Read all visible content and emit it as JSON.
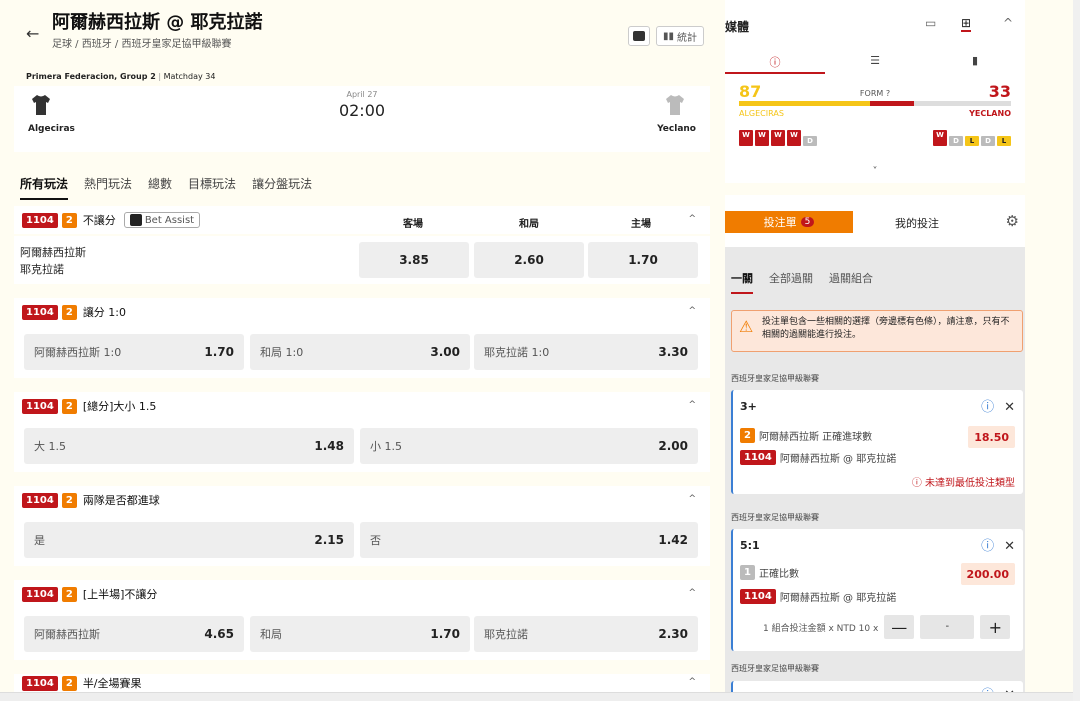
{
  "header": {
    "back_icon": "back-arrow-icon",
    "title": "阿爾赫西拉斯 @ 耶克拉諾",
    "breadcrumb": "足球 / 西班牙 / 西班牙皇家足協甲級聯賽",
    "stats_label": "統計"
  },
  "match": {
    "competition": "Primera Federacion, Group 2",
    "matchday": "Matchday 34",
    "date": "April 27",
    "time": "02:00",
    "home": "Algeciras",
    "away": "Yeclano"
  },
  "tabs": [
    "所有玩法",
    "熱門玩法",
    "總數",
    "目標玩法",
    "讓分盤玩法"
  ],
  "markets": {
    "m1": {
      "code": "1104",
      "num": "2",
      "name": "不讓分",
      "bet_assist": "Bet Assist",
      "cols": [
        "客場",
        "和局",
        "主場"
      ],
      "teams_line1": "阿爾赫西拉斯",
      "teams_line2": "耶克拉諾",
      "odds": [
        "3.85",
        "2.60",
        "1.70"
      ]
    },
    "m2": {
      "code": "1104",
      "num": "2",
      "name": "讓分 1:0",
      "sel": [
        [
          "阿爾赫西拉斯 1:0",
          "1.70"
        ],
        [
          "和局 1:0",
          "3.00"
        ],
        [
          "耶克拉諾 1:0",
          "3.30"
        ]
      ]
    },
    "m3": {
      "code": "1104",
      "num": "2",
      "name": "[總分]大小 1.5",
      "sel": [
        [
          "大 1.5",
          "1.48"
        ],
        [
          "小 1.5",
          "2.00"
        ]
      ]
    },
    "m4": {
      "code": "1104",
      "num": "2",
      "name": "兩隊是否都進球",
      "sel": [
        [
          "是",
          "2.15"
        ],
        [
          "否",
          "1.42"
        ]
      ]
    },
    "m5": {
      "code": "1104",
      "num": "2",
      "name": "[上半場]不讓分",
      "sel": [
        [
          "阿爾赫西拉斯",
          "4.65"
        ],
        [
          "和局",
          "1.70"
        ],
        [
          "耶克拉諾",
          "2.30"
        ]
      ]
    },
    "m6": {
      "code": "1104",
      "num": "2",
      "name": "半/全場賽果"
    }
  },
  "media": {
    "title": "媒體",
    "form_label": "FORM",
    "home_form": "87",
    "away_form": "33",
    "home_team": "ALGECIRAS",
    "away_team": "YECLANO",
    "home_results": [
      "W",
      "W",
      "W",
      "W",
      "D"
    ],
    "away_results": [
      "W",
      "D",
      "L",
      "D",
      "L"
    ]
  },
  "slip": {
    "tab_label": "投注單",
    "count": "5",
    "mybets": "我的投注",
    "subtabs": [
      "一關",
      "全部過關",
      "過關組合"
    ],
    "warning": "投注單包含一些相關的選擇（旁邊標有色條），請注意，只有不相關的過關能進行投注。",
    "league": "西班牙皇家足協甲級聯賽",
    "bet1": {
      "score": "3+",
      "num": "2",
      "market": "阿爾赫西拉斯 正確進球數",
      "odds": "18.50",
      "code": "1104",
      "match": "阿爾赫西拉斯 @ 耶克拉諾",
      "warn": "未達到最低投注類型"
    },
    "bet2": {
      "score": "5:1",
      "num": "1",
      "market": "正確比數",
      "odds": "200.00",
      "code": "1104",
      "match": "阿爾赫西拉斯 @ 耶克拉諾",
      "stake_text": "1 組合投注金額 x NTD 10 x",
      "stake_value": "-",
      "minus": "—",
      "plus": "+"
    }
  },
  "colors": {
    "brand_red": "#c0161b",
    "brand_orange": "#f07c00",
    "form_yellow": "#f5c518"
  }
}
